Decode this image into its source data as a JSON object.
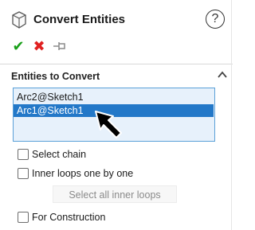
{
  "header": {
    "title": "Convert Entities",
    "help_glyph": "?",
    "icon": "convert-entities-icon"
  },
  "actions": {
    "ok_glyph": "✔",
    "cancel_glyph": "✖",
    "pin_glyph": "⊣⊢"
  },
  "group": {
    "title": "Entities to Convert",
    "items": [
      {
        "label": "Arc2@Sketch1",
        "selected": false
      },
      {
        "label": "Arc1@Sketch1",
        "selected": true
      }
    ]
  },
  "options": {
    "select_chain": {
      "label": "Select chain",
      "checked": false
    },
    "inner_loops": {
      "label": "Inner loops one by one",
      "checked": false
    },
    "select_all_inner": {
      "label": "Select all inner loops",
      "enabled": false
    },
    "for_construction": {
      "label": "For Construction",
      "checked": false
    }
  },
  "colors": {
    "accent": "#2378c8",
    "list_bg": "#e7f1fb",
    "list_border": "#5aa0d8",
    "ok": "#1aa01a",
    "cancel": "#e02020"
  }
}
